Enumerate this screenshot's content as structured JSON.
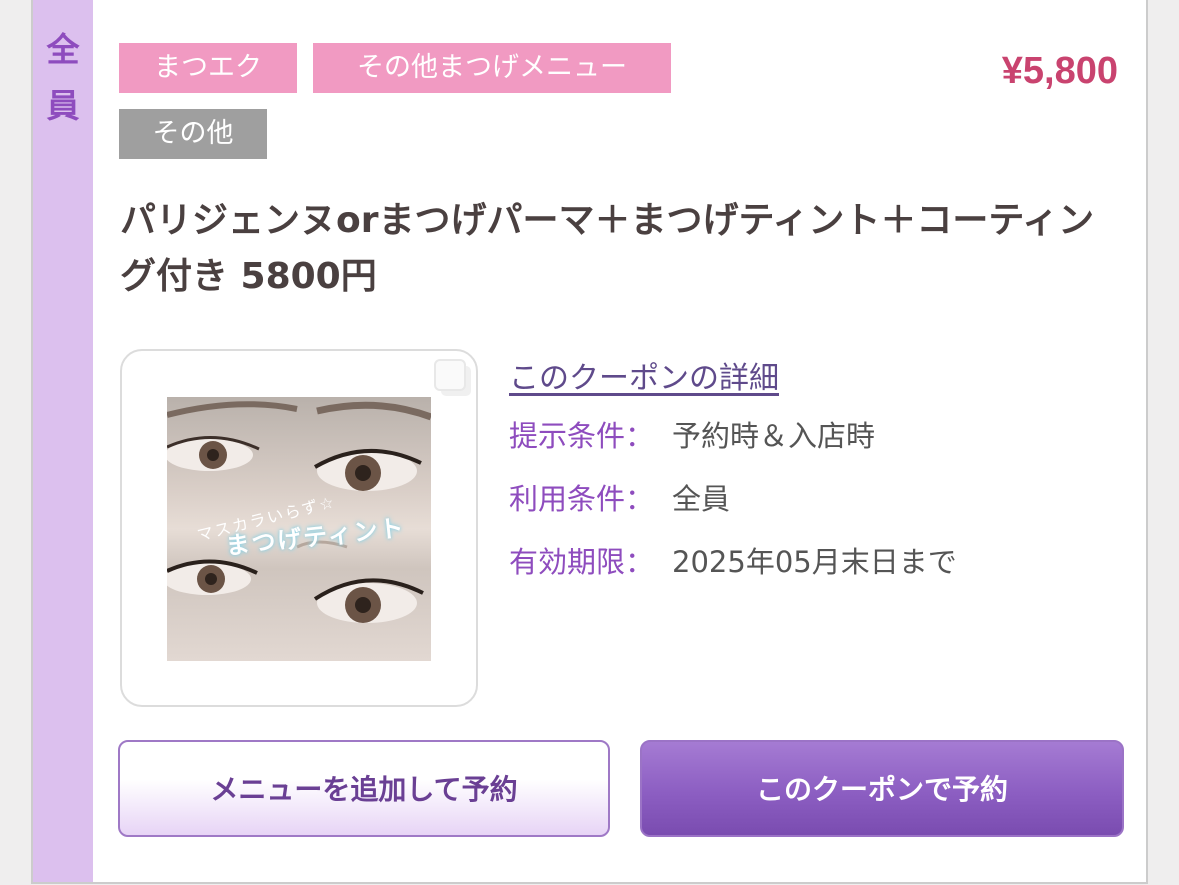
{
  "badge": {
    "chars": [
      "全",
      "員"
    ]
  },
  "tags": [
    "まつエク",
    "その他まつげメニュー",
    "その他"
  ],
  "price": "¥5,800",
  "title": "パリジェンヌorまつげパーマ＋まつげティント＋コーティング付き  5800円",
  "thumbnail": {
    "caption_small": "マスカラいらず☆",
    "caption_large": "まつげティント"
  },
  "details": {
    "link_text": "このクーポンの詳細",
    "rows": [
      {
        "label": "提示条件：",
        "value": "予約時＆入店時"
      },
      {
        "label": "利用条件：",
        "value": "全員"
      },
      {
        "label": "有効期限：",
        "value": "2025年05月末日まで"
      }
    ]
  },
  "buttons": {
    "add_menu": "メニューを追加して予約",
    "book_coupon": "このクーポンで予約"
  },
  "colors": {
    "accent_purple": "#8e4cbe",
    "side_strip": "#dcc0ee",
    "tag_pink": "#f19ac2",
    "tag_gray": "#9f9f9f",
    "price_red": "#c9436f"
  }
}
